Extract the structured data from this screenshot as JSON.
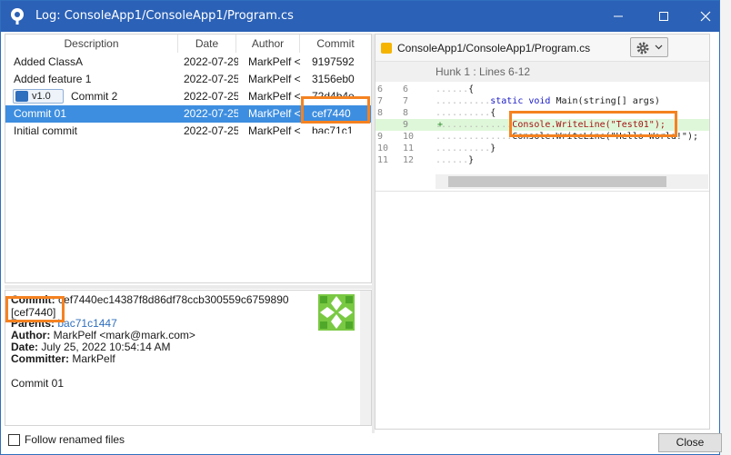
{
  "window": {
    "title": "Log: ConsoleApp1/ConsoleApp1/Program.cs",
    "minimize_label": "—",
    "maximize_label": "☐",
    "close_label": "✕"
  },
  "log": {
    "columns": [
      "Description",
      "Date",
      "Author",
      "Commit"
    ],
    "rows": [
      {
        "description": "Added ClassA",
        "date": "2022-07-29",
        "author": "MarkPelf <",
        "commit": "9197592",
        "tag": "",
        "selected": false
      },
      {
        "description": "Added feature 1",
        "date": "2022-07-25",
        "author": "MarkPelf <",
        "commit": "3156eb0",
        "tag": "",
        "selected": false
      },
      {
        "description": "Commit 2",
        "date": "2022-07-25",
        "author": "MarkPelf <",
        "commit": "72d4b4e",
        "tag": "v1.0",
        "selected": false
      },
      {
        "description": "Commit 01",
        "date": "2022-07-25",
        "author": "MarkPelf <",
        "commit": "cef7440",
        "tag": "",
        "selected": true
      },
      {
        "description": "Initial commit",
        "date": "2022-07-25",
        "author": "MarkPelf <",
        "commit": "bac71c1",
        "tag": "",
        "selected": false
      }
    ]
  },
  "details": {
    "commit_label": "Commit:",
    "commit_hash": "cef7440ec14387f8d86df78ccb300559c6759890",
    "commit_short": "[cef7440]",
    "parents_label": "Parents:",
    "parents_value": "bac71c1447",
    "author_label": "Author:",
    "author_value": "MarkPelf <mark@mark.com>",
    "date_label": "Date:",
    "date_value": "July 25, 2022 10:54:14 AM",
    "committer_label": "Committer:",
    "committer_value": "MarkPelf",
    "message": "Commit 01"
  },
  "follow_renamed_label": "Follow renamed files",
  "diff": {
    "file_name": "ConsoleApp1/ConsoleApp1/Program.cs",
    "hunk_header": "Hunk 1 : Lines 6-12",
    "lines": [
      {
        "old": "6",
        "new": "6",
        "dots": "......",
        "text": "{",
        "added": false
      },
      {
        "old": "7",
        "new": "7",
        "dots": "..........",
        "kw": "static void",
        "text": " Main(string[] args)",
        "added": false
      },
      {
        "old": "8",
        "new": "8",
        "dots": "..........",
        "text": "{",
        "added": false
      },
      {
        "old": "",
        "new": "9",
        "dots": "..............",
        "text": "Console.WriteLine(\"Test01\");",
        "added": true
      },
      {
        "old": "9",
        "new": "10",
        "dots": "..............",
        "text": "Console.WriteLine(\"Hello World!\");",
        "added": false
      },
      {
        "old": "10",
        "new": "11",
        "dots": "..........",
        "text": "}",
        "added": false
      },
      {
        "old": "11",
        "new": "12",
        "dots": "......",
        "text": "}",
        "added": false
      }
    ],
    "added_marker": "+"
  },
  "close_button_label": "Close",
  "colors": {
    "titlebar": "#2b61b6",
    "selection": "#3d8ee0",
    "highlight": "#f58220",
    "added_line": "#dff7d9"
  }
}
